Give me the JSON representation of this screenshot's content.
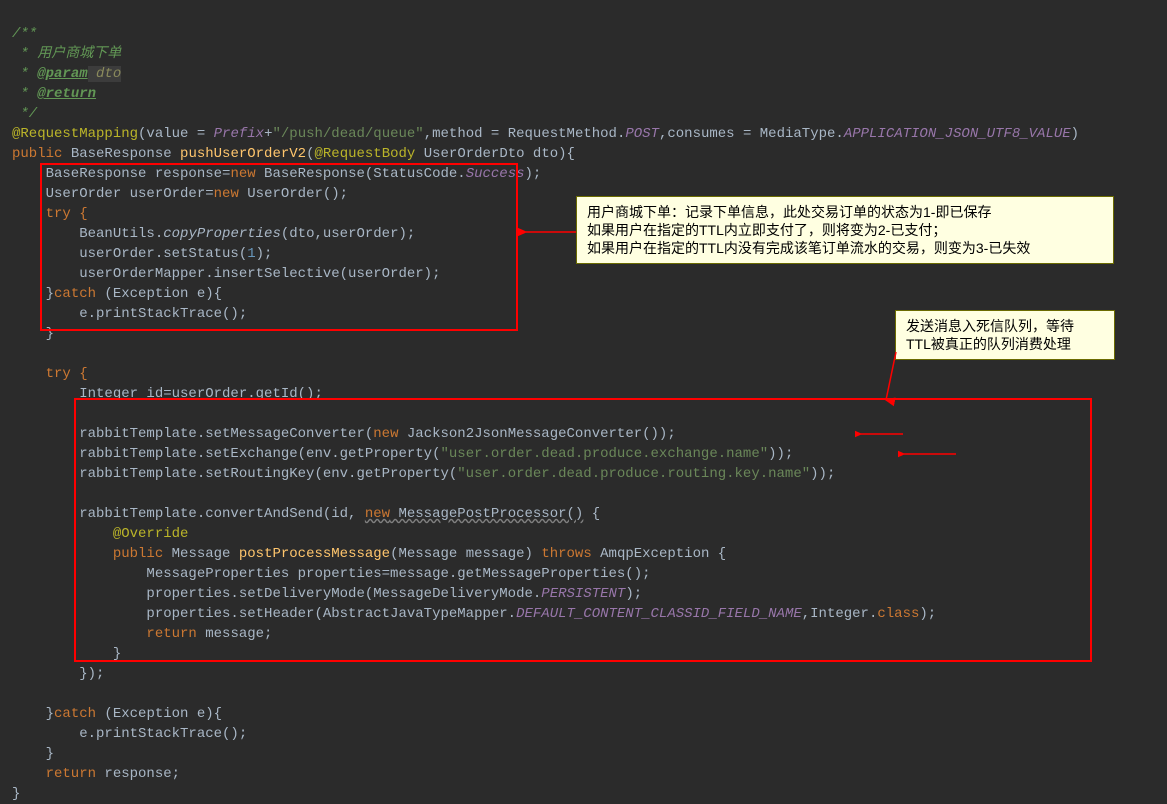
{
  "doc": {
    "open": "/**",
    "l1": " * 用户商城下单",
    "l2_prefix": " * ",
    "l2_tag": "@param",
    "l2_param": " dto",
    "l3_prefix": " * ",
    "l3_tag": "@return",
    "close": " */"
  },
  "line_annotation": "@RequestMapping",
  "ann_parts": {
    "p1": "(value = ",
    "prefix": "Prefix",
    "p2": "+",
    "str1": "\"/push/dead/queue\"",
    "p3": ",method = RequestMethod.",
    "post": "POST",
    "p4": ",consumes = MediaType.",
    "utf8": "APPLICATION_JSON_UTF8_VALUE",
    "p5": ")"
  },
  "sig": {
    "kw1": "public",
    "type": " BaseResponse ",
    "name": "pushUserOrderV2",
    "open": "(",
    "ann2": "@RequestBody",
    "param": " UserOrderDto dto){"
  },
  "body": {
    "l1_a": "    BaseResponse response=",
    "l1_new": "new",
    "l1_b": " BaseResponse(StatusCode.",
    "l1_succ": "Success",
    "l1_c": ");",
    "l2_a": "    UserOrder userOrder=",
    "l2_new": "new",
    "l2_b": " UserOrder();",
    "l3": "    try {",
    "l4_a": "        BeanUtils.",
    "l4_call": "copyProperties",
    "l4_b": "(dto,userOrder);",
    "l5": "        userOrder.setStatus(",
    "l5_num": "1",
    "l5_b": ");",
    "l6": "        userOrderMapper.insertSelective(userOrder);",
    "l7_a": "    }",
    "l7_kw": "catch",
    "l7_b": " (Exception e){",
    "l8": "        e.printStackTrace();",
    "l9": "    }",
    "blank": "",
    "l11": "    try {",
    "l12": "        Integer id=userOrder.getId();",
    "l14_a": "        rabbitTemplate.setMessageConverter(",
    "l14_new": "new",
    "l14_b": " Jackson2JsonMessageConverter());",
    "l15_a": "        rabbitTemplate.setExchange(env.getProperty(",
    "l15_str": "\"user.order.dead.produce.exchange.name\"",
    "l15_b": "));",
    "l16_a": "        rabbitTemplate.setRoutingKey(env.getProperty(",
    "l16_str": "\"user.order.dead.produce.routing.key.name\"",
    "l16_b": "));",
    "l18_a": "        rabbitTemplate.convertAndSend(id, ",
    "l18_new": "new",
    "l18_b": " MessagePostProcessor()",
    "l18_c": " {",
    "l19": "            @Override",
    "l20_a": "            public",
    "l20_b": " Message ",
    "l20_name": "postProcessMessage",
    "l20_c": "(Message message) ",
    "l20_kw": "throws",
    "l20_d": " AmqpException {",
    "l21": "                MessageProperties properties=message.getMessageProperties();",
    "l22_a": "                properties.setDeliveryMode(MessageDeliveryMode.",
    "l22_p": "PERSISTENT",
    "l22_b": ");",
    "l23_a": "                properties.setHeader(AbstractJavaTypeMapper.",
    "l23_c": "DEFAULT_CONTENT_CLASSID_FIELD_NAME",
    "l23_b": ",Integer.",
    "l23_kw": "class",
    "l23_d": ");",
    "l24_a": "                return",
    "l24_b": " message;",
    "l25": "            }",
    "l26": "        });",
    "l28_a": "    }",
    "l28_kw": "catch",
    "l28_b": " (Exception e){",
    "l29": "        e.printStackTrace();",
    "l30": "    }",
    "l31_a": "    return",
    "l31_b": " response;",
    "l32": "}"
  },
  "callout1": {
    "line1": "用户商城下单：记录下单信息，此处交易订单的状态为1-即已保存",
    "line2": "如果用户在指定的TTL内立即支付了，则将变为2-已支付；",
    "line3": "如果用户在指定的TTL内没有完成该笔订单流水的交易，则变为3-已失效"
  },
  "callout2": {
    "line1": "发送消息入死信队列，等待",
    "line2": "TTL被真正的队列消费处理"
  }
}
